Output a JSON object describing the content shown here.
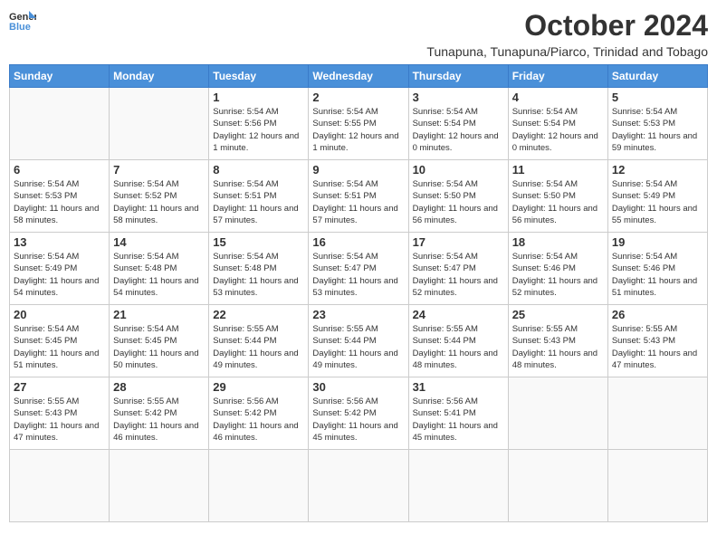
{
  "header": {
    "logo_general": "General",
    "logo_blue": "Blue",
    "month_title": "October 2024",
    "location": "Tunapuna, Tunapuna/Piarco, Trinidad and Tobago"
  },
  "weekdays": [
    "Sunday",
    "Monday",
    "Tuesday",
    "Wednesday",
    "Thursday",
    "Friday",
    "Saturday"
  ],
  "days": [
    {
      "day": "",
      "empty": true
    },
    {
      "day": "",
      "empty": true
    },
    {
      "day": "1",
      "sunrise": "5:54 AM",
      "sunset": "5:56 PM",
      "daylight": "12 hours and 1 minute."
    },
    {
      "day": "2",
      "sunrise": "5:54 AM",
      "sunset": "5:55 PM",
      "daylight": "12 hours and 1 minute."
    },
    {
      "day": "3",
      "sunrise": "5:54 AM",
      "sunset": "5:54 PM",
      "daylight": "12 hours and 0 minutes."
    },
    {
      "day": "4",
      "sunrise": "5:54 AM",
      "sunset": "5:54 PM",
      "daylight": "12 hours and 0 minutes."
    },
    {
      "day": "5",
      "sunrise": "5:54 AM",
      "sunset": "5:53 PM",
      "daylight": "11 hours and 59 minutes."
    },
    {
      "day": "6",
      "sunrise": "5:54 AM",
      "sunset": "5:53 PM",
      "daylight": "11 hours and 58 minutes."
    },
    {
      "day": "7",
      "sunrise": "5:54 AM",
      "sunset": "5:52 PM",
      "daylight": "11 hours and 58 minutes."
    },
    {
      "day": "8",
      "sunrise": "5:54 AM",
      "sunset": "5:51 PM",
      "daylight": "11 hours and 57 minutes."
    },
    {
      "day": "9",
      "sunrise": "5:54 AM",
      "sunset": "5:51 PM",
      "daylight": "11 hours and 57 minutes."
    },
    {
      "day": "10",
      "sunrise": "5:54 AM",
      "sunset": "5:50 PM",
      "daylight": "11 hours and 56 minutes."
    },
    {
      "day": "11",
      "sunrise": "5:54 AM",
      "sunset": "5:50 PM",
      "daylight": "11 hours and 56 minutes."
    },
    {
      "day": "12",
      "sunrise": "5:54 AM",
      "sunset": "5:49 PM",
      "daylight": "11 hours and 55 minutes."
    },
    {
      "day": "13",
      "sunrise": "5:54 AM",
      "sunset": "5:49 PM",
      "daylight": "11 hours and 54 minutes."
    },
    {
      "day": "14",
      "sunrise": "5:54 AM",
      "sunset": "5:48 PM",
      "daylight": "11 hours and 54 minutes."
    },
    {
      "day": "15",
      "sunrise": "5:54 AM",
      "sunset": "5:48 PM",
      "daylight": "11 hours and 53 minutes."
    },
    {
      "day": "16",
      "sunrise": "5:54 AM",
      "sunset": "5:47 PM",
      "daylight": "11 hours and 53 minutes."
    },
    {
      "day": "17",
      "sunrise": "5:54 AM",
      "sunset": "5:47 PM",
      "daylight": "11 hours and 52 minutes."
    },
    {
      "day": "18",
      "sunrise": "5:54 AM",
      "sunset": "5:46 PM",
      "daylight": "11 hours and 52 minutes."
    },
    {
      "day": "19",
      "sunrise": "5:54 AM",
      "sunset": "5:46 PM",
      "daylight": "11 hours and 51 minutes."
    },
    {
      "day": "20",
      "sunrise": "5:54 AM",
      "sunset": "5:45 PM",
      "daylight": "11 hours and 51 minutes."
    },
    {
      "day": "21",
      "sunrise": "5:54 AM",
      "sunset": "5:45 PM",
      "daylight": "11 hours and 50 minutes."
    },
    {
      "day": "22",
      "sunrise": "5:55 AM",
      "sunset": "5:44 PM",
      "daylight": "11 hours and 49 minutes."
    },
    {
      "day": "23",
      "sunrise": "5:55 AM",
      "sunset": "5:44 PM",
      "daylight": "11 hours and 49 minutes."
    },
    {
      "day": "24",
      "sunrise": "5:55 AM",
      "sunset": "5:44 PM",
      "daylight": "11 hours and 48 minutes."
    },
    {
      "day": "25",
      "sunrise": "5:55 AM",
      "sunset": "5:43 PM",
      "daylight": "11 hours and 48 minutes."
    },
    {
      "day": "26",
      "sunrise": "5:55 AM",
      "sunset": "5:43 PM",
      "daylight": "11 hours and 47 minutes."
    },
    {
      "day": "27",
      "sunrise": "5:55 AM",
      "sunset": "5:43 PM",
      "daylight": "11 hours and 47 minutes."
    },
    {
      "day": "28",
      "sunrise": "5:55 AM",
      "sunset": "5:42 PM",
      "daylight": "11 hours and 46 minutes."
    },
    {
      "day": "29",
      "sunrise": "5:56 AM",
      "sunset": "5:42 PM",
      "daylight": "11 hours and 46 minutes."
    },
    {
      "day": "30",
      "sunrise": "5:56 AM",
      "sunset": "5:42 PM",
      "daylight": "11 hours and 45 minutes."
    },
    {
      "day": "31",
      "sunrise": "5:56 AM",
      "sunset": "5:41 PM",
      "daylight": "11 hours and 45 minutes."
    },
    {
      "day": "",
      "empty": true
    },
    {
      "day": "",
      "empty": true
    },
    {
      "day": "",
      "empty": true
    },
    {
      "day": "",
      "empty": true
    }
  ]
}
